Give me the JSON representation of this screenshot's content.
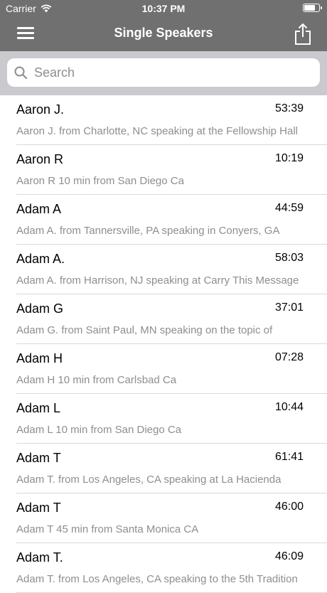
{
  "status_bar": {
    "carrier": "Carrier",
    "time": "10:37 PM"
  },
  "nav": {
    "title": "Single Speakers"
  },
  "search": {
    "placeholder": "Search"
  },
  "speakers": [
    {
      "name": "Aaron J.",
      "duration": "53:39",
      "description": "Aaron J. from Charlotte, NC speaking at the Fellowship Hall"
    },
    {
      "name": "Aaron R",
      "duration": "10:19",
      "description": "Aaron R 10 min from San Diego Ca"
    },
    {
      "name": "Adam A",
      "duration": "44:59",
      "description": "Adam A. from Tannersville, PA speaking in Conyers, GA"
    },
    {
      "name": "Adam A.",
      "duration": "58:03",
      "description": "Adam A. from Harrison, NJ speaking at Carry This Message"
    },
    {
      "name": "Adam G",
      "duration": "37:01",
      "description": "Adam G. from Saint Paul, MN speaking on the topic of"
    },
    {
      "name": "Adam H",
      "duration": "07:28",
      "description": "Adam H 10 min from Carlsbad Ca"
    },
    {
      "name": "Adam L",
      "duration": "10:44",
      "description": "Adam L 10 min from San Diego Ca"
    },
    {
      "name": "Adam T",
      "duration": "61:41",
      "description": "Adam T. from Los Angeles, CA speaking at La Hacienda"
    },
    {
      "name": "Adam T",
      "duration": "46:00",
      "description": "Adam T 45 min from Santa Monica CA"
    },
    {
      "name": "Adam T.",
      "duration": "46:09",
      "description": "Adam T. from Los Angeles, CA speaking to the 5th Tradition"
    }
  ],
  "colors": {
    "header_bg": "#707070",
    "search_bar_bg": "#c9c9ce",
    "secondary_text": "#8e8e93"
  }
}
